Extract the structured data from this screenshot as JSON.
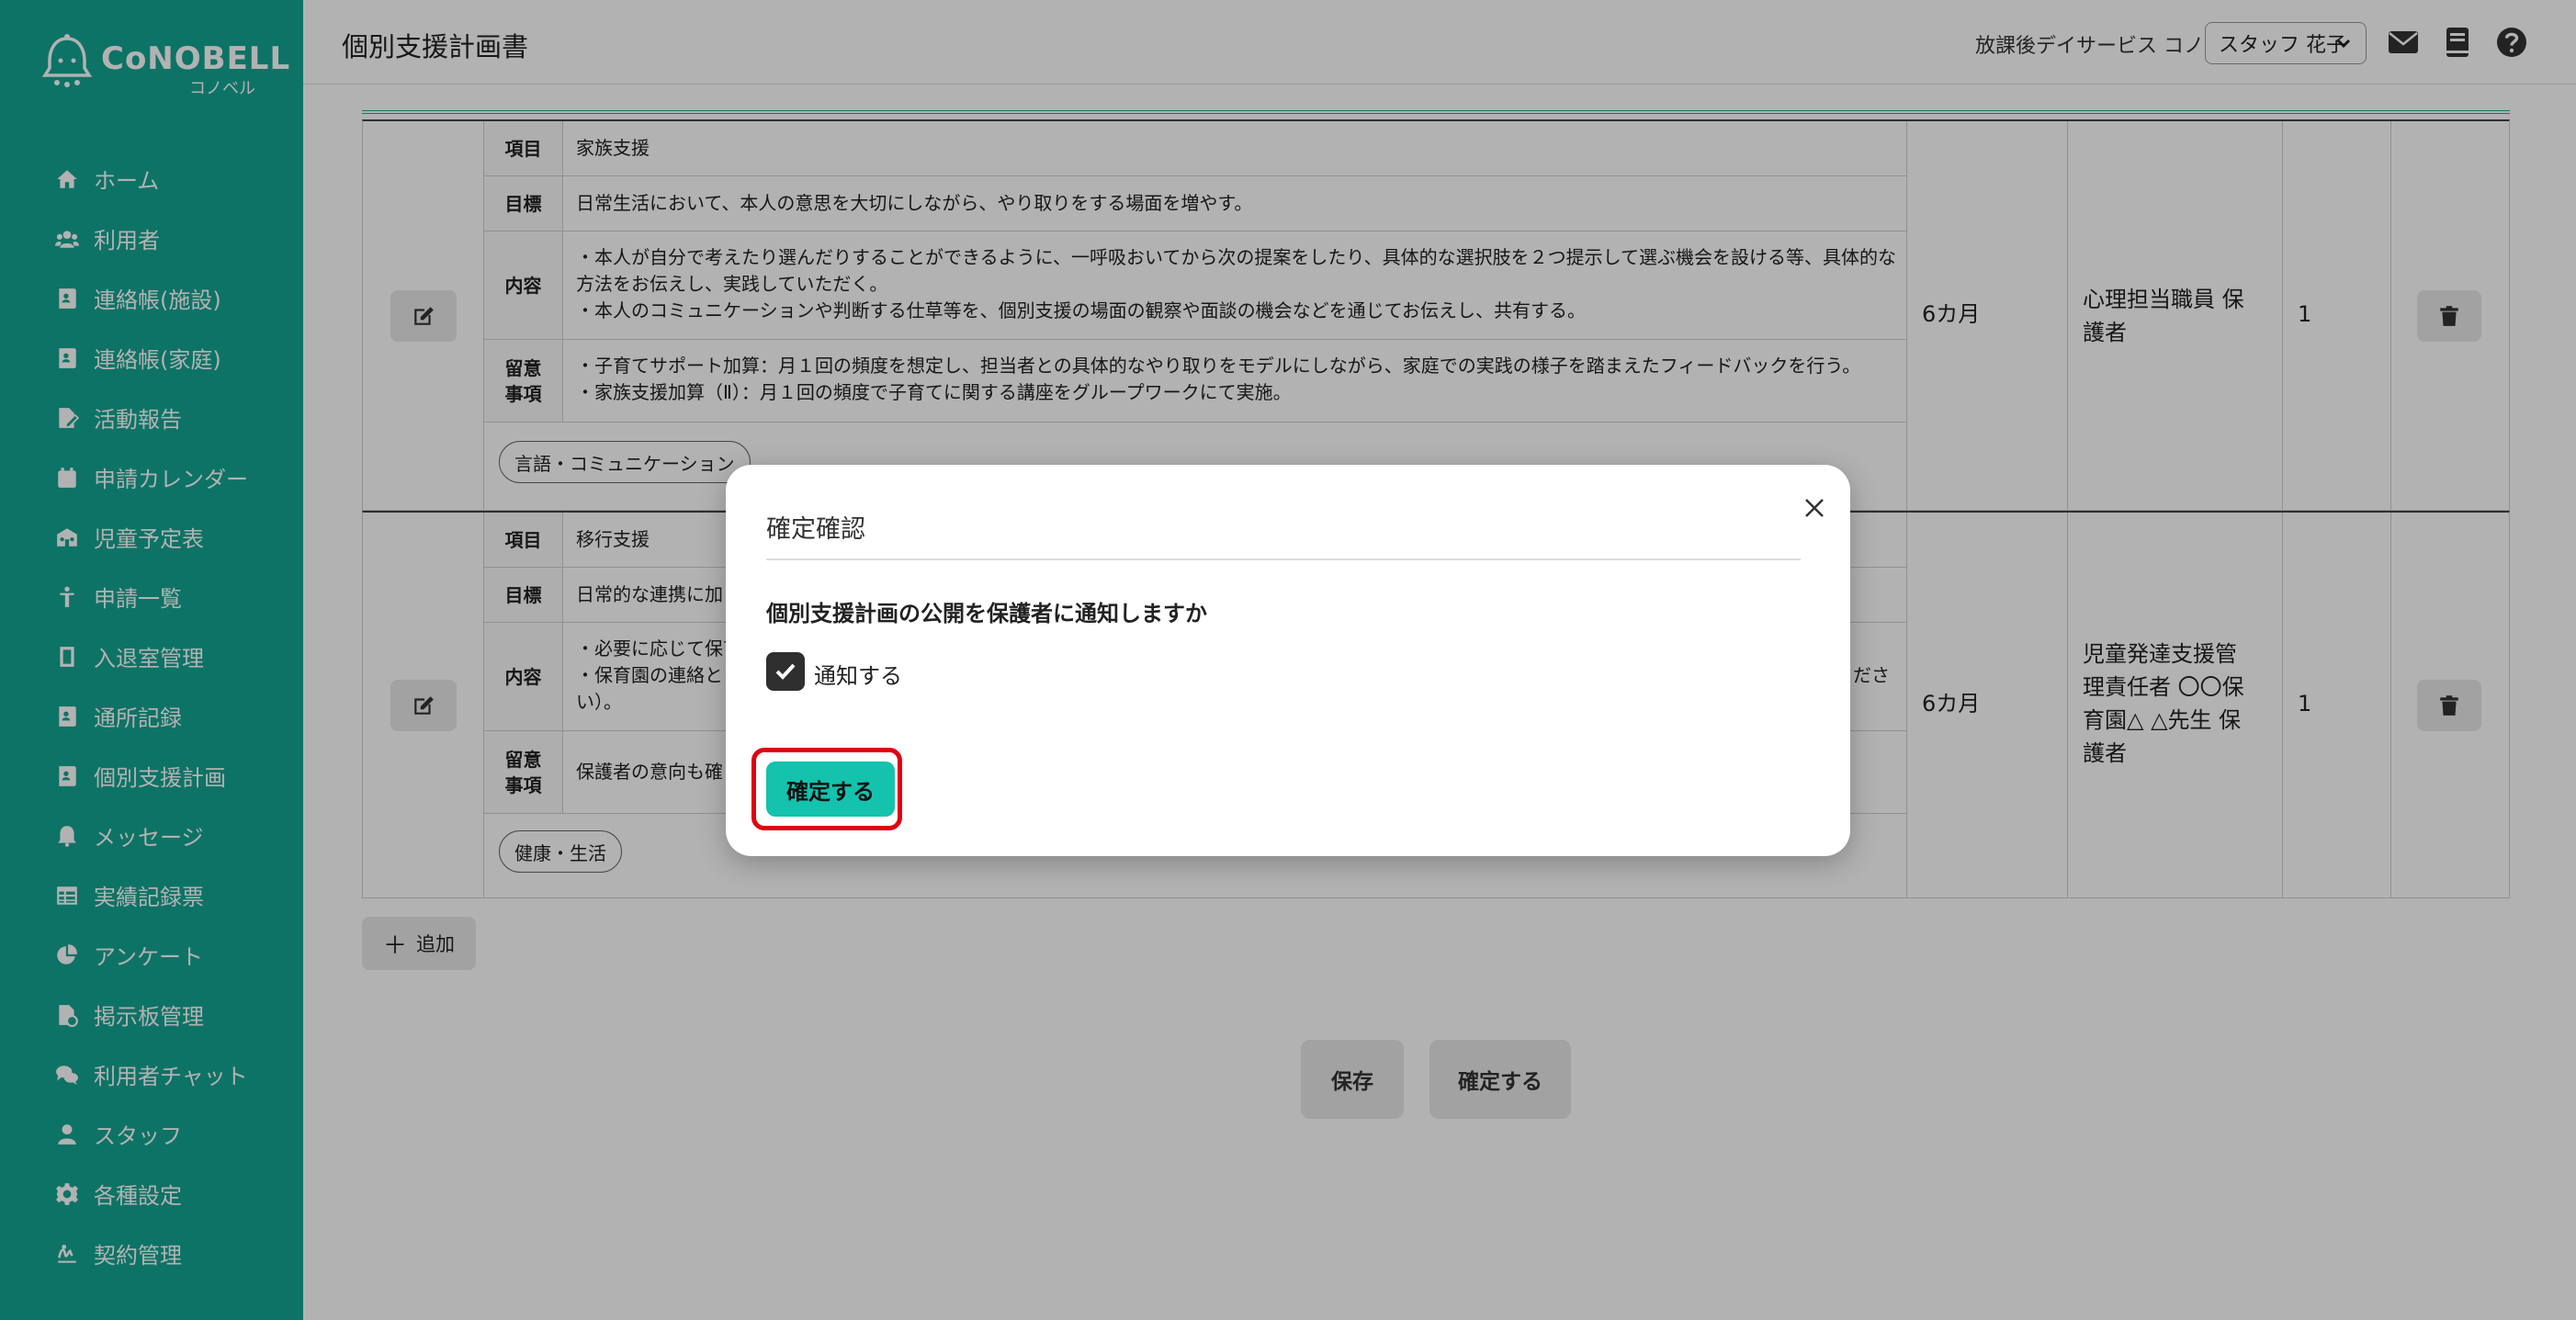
{
  "app": {
    "logo_text": "CoNOBELL",
    "logo_sub": "コノベル",
    "page_title": "個別支援計画書",
    "facility": "放課後デイサービス コノベル",
    "staff_selected": "スタッフ 花子"
  },
  "sidebar": {
    "items": [
      {
        "label": "ホーム",
        "icon": "home-icon"
      },
      {
        "label": "利用者",
        "icon": "users-icon"
      },
      {
        "label": "連絡帳(施設)",
        "icon": "contact-book-icon"
      },
      {
        "label": "連絡帳(家庭)",
        "icon": "contact-book-icon"
      },
      {
        "label": "活動報告",
        "icon": "report-icon"
      },
      {
        "label": "申請カレンダー",
        "icon": "calendar-icon"
      },
      {
        "label": "児童予定表",
        "icon": "schedule-icon"
      },
      {
        "label": "申請一覧",
        "icon": "child-icon"
      },
      {
        "label": "入退室管理",
        "icon": "door-icon"
      },
      {
        "label": "通所記録",
        "icon": "record-icon"
      },
      {
        "label": "個別支援計画",
        "icon": "plan-icon"
      },
      {
        "label": "メッセージ",
        "icon": "bell-icon"
      },
      {
        "label": "実績記録票",
        "icon": "table-icon"
      },
      {
        "label": "アンケート",
        "icon": "pie-icon"
      },
      {
        "label": "掲示板管理",
        "icon": "board-icon"
      },
      {
        "label": "利用者チャット",
        "icon": "chat-icon"
      },
      {
        "label": "スタッフ",
        "icon": "staff-icon"
      },
      {
        "label": "各種設定",
        "icon": "gear-icon"
      },
      {
        "label": "契約管理",
        "icon": "contract-icon"
      }
    ]
  },
  "plans": [
    {
      "item_label": "項目",
      "item": "家族支援",
      "goal_label": "目標",
      "goal": "日常生活において、本人の意思を大切にしながら、やり取りをする場面を増やす。",
      "content_label": "内容",
      "content": "・本人が自分で考えたり選んだりすることができるように、一呼吸おいてから次の提案をしたり、具体的な選択肢を２つ提示して選ぶ機会を設ける等、具体的な方法をお伝えし、実践していただく。\n・本人のコミュニケーションや判断する仕草等を、個別支援の場面の観察や面談の機会などを通じてお伝えし、共有する。",
      "notes_label": "留意\n事項",
      "notes": "・子育てサポート加算：月１回の頻度を想定し、担当者との具体的なやり取りをモデルにしながら、家庭での実践の様子を踏まえたフィードバックを行う。\n・家族支援加算（Ⅱ）：月１回の頻度で子育てに関する講座をグループワークにて実施。",
      "tag": "言語・コミュニケーション",
      "period": "6カ月",
      "staff": "心理担当職員 保\n護者",
      "priority": "1"
    },
    {
      "item_label": "項目",
      "item": "移行支援",
      "goal_label": "目標",
      "goal": "日常的な連携に加",
      "content_label": "内容",
      "content": "・必要に応じて保育\n・保育園の連絡と",
      "content_tail": "ださ",
      "content_line3": "い）。",
      "notes_label": "留意\n事項",
      "notes": "保護者の意向も確",
      "tag": "健康・生活",
      "period": "6カ月",
      "staff": "児童発達支援管\n理責任者 〇〇保\n育園△ △先生 保\n護者",
      "priority": "1"
    }
  ],
  "actions": {
    "add": "追加",
    "save": "保存",
    "confirm": "確定する"
  },
  "modal": {
    "title": "確定確認",
    "question": "個別支援計画の公開を保護者に通知しますか",
    "checkbox_label": "通知する",
    "checkbox_checked": true,
    "confirm": "確定する"
  },
  "colors": {
    "brand": "#13a593",
    "accent_button": "#14c2ae",
    "highlight": "#e00010"
  }
}
